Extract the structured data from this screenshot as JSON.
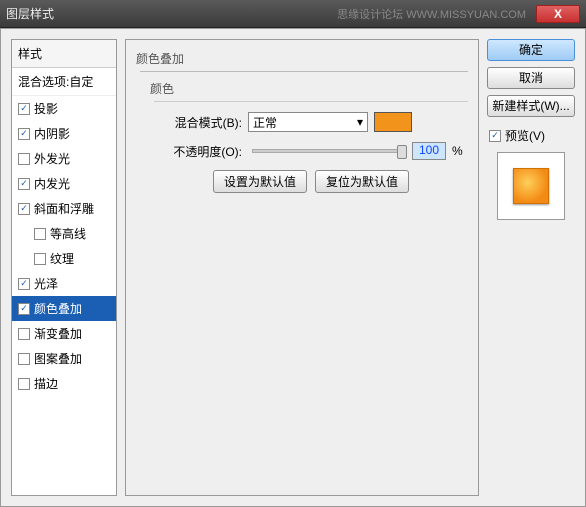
{
  "window": {
    "title": "图层样式",
    "watermark": "思缘设计论坛  WWW.MISSYUAN.COM",
    "close": "X"
  },
  "left": {
    "header": "样式",
    "sub": "混合选项:自定",
    "items": [
      {
        "label": "投影",
        "checked": true,
        "indent": false,
        "selected": false
      },
      {
        "label": "内阴影",
        "checked": true,
        "indent": false,
        "selected": false
      },
      {
        "label": "外发光",
        "checked": false,
        "indent": false,
        "selected": false
      },
      {
        "label": "内发光",
        "checked": true,
        "indent": false,
        "selected": false
      },
      {
        "label": "斜面和浮雕",
        "checked": true,
        "indent": false,
        "selected": false
      },
      {
        "label": "等高线",
        "checked": false,
        "indent": true,
        "selected": false
      },
      {
        "label": "纹理",
        "checked": false,
        "indent": true,
        "selected": false
      },
      {
        "label": "光泽",
        "checked": true,
        "indent": false,
        "selected": false
      },
      {
        "label": "颜色叠加",
        "checked": true,
        "indent": false,
        "selected": true
      },
      {
        "label": "渐变叠加",
        "checked": false,
        "indent": false,
        "selected": false
      },
      {
        "label": "图案叠加",
        "checked": false,
        "indent": false,
        "selected": false
      },
      {
        "label": "描边",
        "checked": false,
        "indent": false,
        "selected": false
      }
    ]
  },
  "center": {
    "title": "颜色叠加",
    "sub_title": "颜色",
    "blend_label": "混合模式(B):",
    "blend_value": "正常",
    "opacity_label": "不透明度(O):",
    "opacity_value": "100",
    "opacity_unit": "%",
    "btn_default": "设置为默认值",
    "btn_reset": "复位为默认值",
    "swatch_color": "#f2941b"
  },
  "right": {
    "ok": "确定",
    "cancel": "取消",
    "new_style": "新建样式(W)...",
    "preview_label": "预览(V)"
  }
}
